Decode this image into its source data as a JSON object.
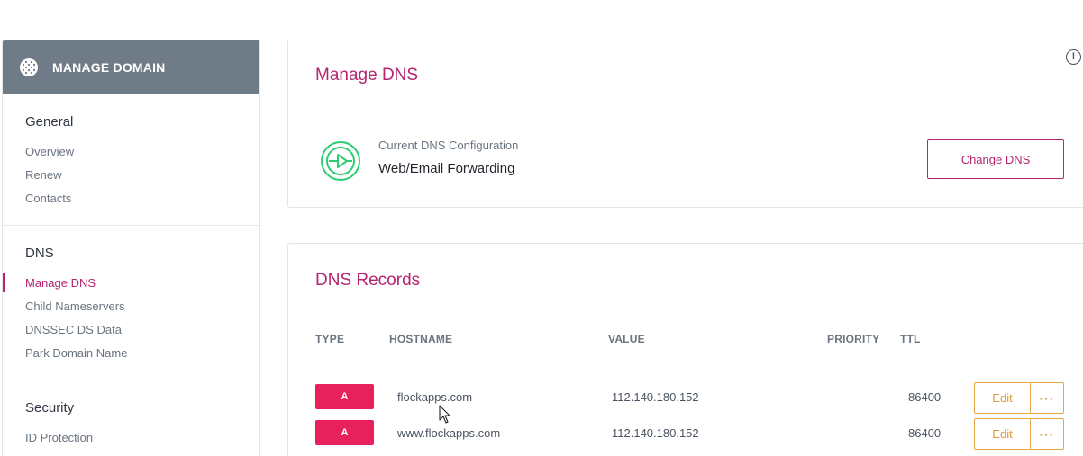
{
  "sidebar": {
    "header": {
      "title": "MANAGE DOMAIN",
      "icon": "globe-icon"
    },
    "sections": [
      {
        "title": "General",
        "items": [
          "Overview",
          "Renew",
          "Contacts"
        ]
      },
      {
        "title": "DNS",
        "items": [
          "Manage DNS",
          "Child Nameservers",
          "DNSSEC DS Data",
          "Park Domain Name"
        ],
        "active_item": "Manage DNS"
      },
      {
        "title": "Security",
        "items": [
          "ID Protection"
        ]
      }
    ]
  },
  "manage_dns": {
    "title": "Manage DNS",
    "config_label": "Current DNS Configuration",
    "config_value": "Web/Email Forwarding",
    "change_button": "Change DNS",
    "info_icon": "info-icon"
  },
  "dns_records": {
    "title": "DNS Records",
    "columns": {
      "type": "TYPE",
      "hostname": "HOSTNAME",
      "value": "VALUE",
      "priority": "PRIORITY",
      "ttl": "TTL"
    },
    "rows": [
      {
        "type": "A",
        "hostname": "flockapps.com",
        "value": "112.140.180.152",
        "priority": "",
        "ttl": "86400",
        "edit": "Edit",
        "more": "···"
      },
      {
        "type": "A",
        "hostname": "www.flockapps.com",
        "value": "112.140.180.152",
        "priority": "",
        "ttl": "86400",
        "edit": "Edit",
        "more": "···"
      }
    ]
  },
  "colors": {
    "accent": "#b4246f",
    "badge": "#e6215c",
    "edit": "#e8a64a",
    "sidebar_header": "#6f7b87",
    "config_icon": "#2ecc71"
  }
}
